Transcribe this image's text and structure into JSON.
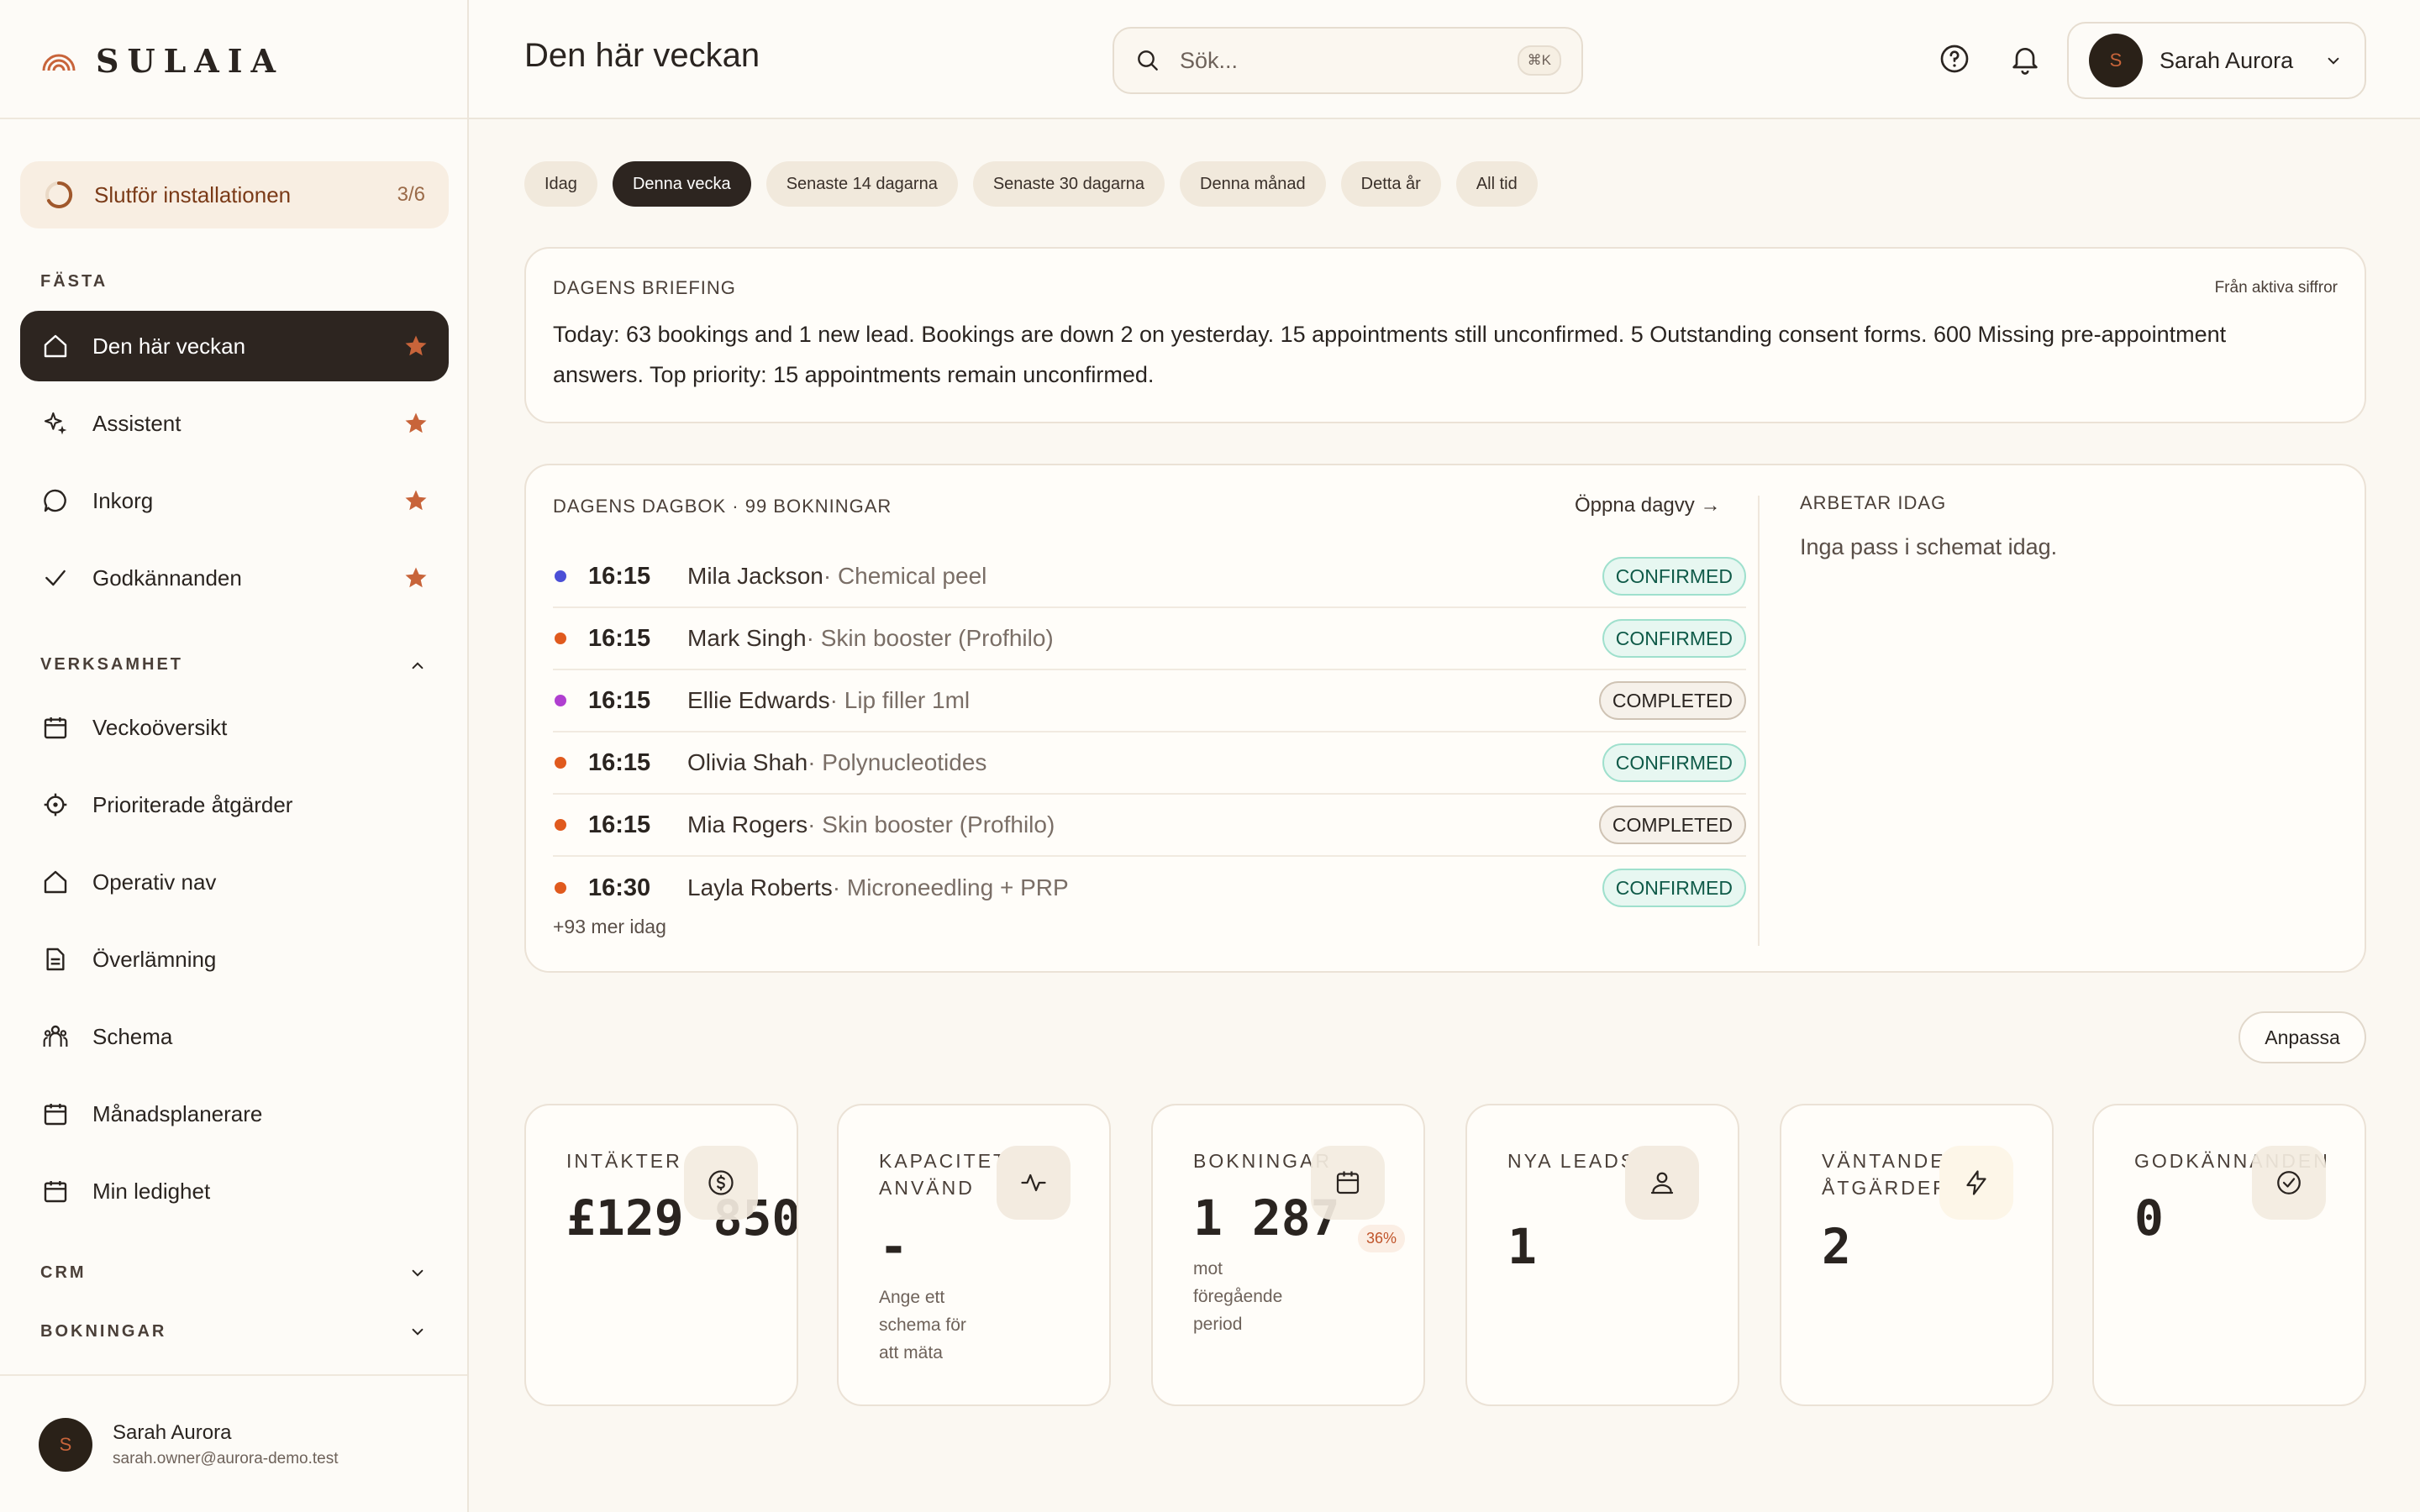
{
  "brand": {
    "name": "SULAIA"
  },
  "colors": {
    "accent": "#c8643a",
    "dark": "#2d2520",
    "confirmed": "#0f5a48"
  },
  "sidebar": {
    "setup": {
      "label": "Slutför installationen",
      "count": "3/6"
    },
    "pinned_label": "FÄSTA",
    "pinned": [
      {
        "label": "Den här veckan",
        "icon": "home-icon",
        "active": true
      },
      {
        "label": "Assistent",
        "icon": "sparkles-icon"
      },
      {
        "label": "Inkorg",
        "icon": "chat-bubble-icon"
      },
      {
        "label": "Godkännanden",
        "icon": "check-icon"
      }
    ],
    "business_label": "VERKSAMHET",
    "business": [
      {
        "label": "Veckoöversikt",
        "icon": "calendar-icon"
      },
      {
        "label": "Prioriterade åtgärder",
        "icon": "target-icon"
      },
      {
        "label": "Operativ nav",
        "icon": "home-icon"
      },
      {
        "label": "Överlämning",
        "icon": "document-icon"
      },
      {
        "label": "Schema",
        "icon": "people-icon"
      },
      {
        "label": "Månadsplanerare",
        "icon": "calendar-icon"
      },
      {
        "label": "Min ledighet",
        "icon": "calendar-icon"
      }
    ],
    "crm_label": "CRM",
    "bookings_label": "BOKNINGAR",
    "user": {
      "initial": "S",
      "name": "Sarah Aurora",
      "email": "sarah.owner@aurora-demo.test"
    }
  },
  "header": {
    "title": "Den här veckan",
    "search_placeholder": "Sök...",
    "search_shortcut": "⌘K",
    "user": {
      "initial": "S",
      "name": "Sarah Aurora"
    }
  },
  "filters": [
    "Idag",
    "Denna vecka",
    "Senaste 14 dagarna",
    "Senaste 30 dagarna",
    "Denna månad",
    "Detta år",
    "All tid"
  ],
  "active_filter": "Denna vecka",
  "briefing": {
    "heading": "DAGENS BRIEFING",
    "source": "Från aktiva siffror",
    "text": "Today: 63 bookings and 1 new lead. Bookings are down 2 on yesterday. 15 appointments still unconfirmed. 5 Outstanding consent forms. 600 Missing pre-appointment answers. Top priority: 15 appointments remain unconfirmed."
  },
  "diary": {
    "heading": "DAGENS DAGBOK · 99 BOKNINGAR",
    "open_link": "Öppna dagvy →",
    "rows": [
      {
        "color": "#4b4fd6",
        "time": "16:15",
        "client": "Mila Jackson",
        "service": " · Chemical peel",
        "status": "CONFIRMED"
      },
      {
        "color": "#e05a1e",
        "time": "16:15",
        "client": "Mark Singh",
        "service": " · Skin booster (Profhilo)",
        "status": "CONFIRMED"
      },
      {
        "color": "#b03fd0",
        "time": "16:15",
        "client": "Ellie Edwards",
        "service": " · Lip filler 1ml",
        "status": "COMPLETED"
      },
      {
        "color": "#e05a1e",
        "time": "16:15",
        "client": "Olivia Shah",
        "service": " · Polynucleotides",
        "status": "CONFIRMED"
      },
      {
        "color": "#e05a1e",
        "time": "16:15",
        "client": "Mia Rogers",
        "service": " · Skin booster (Profhilo)",
        "status": "COMPLETED"
      },
      {
        "color": "#e05a1e",
        "time": "16:30",
        "client": "Layla Roberts",
        "service": " · Microneedling + PRP",
        "status": "CONFIRMED"
      }
    ],
    "more": "+93 mer idag",
    "working_heading": "ARBETAR IDAG",
    "working_text": "Inga pass i schemat idag."
  },
  "customize_label": "Anpassa",
  "kpis": [
    {
      "label": "INTÄKTER",
      "icon": "dollar-icon",
      "value": "£129 850"
    },
    {
      "label": "KAPACITET ANVÄND",
      "icon": "activity-icon",
      "value": "-",
      "sub": "Ange ett schema för att mäta"
    },
    {
      "label": "BOKNINGAR",
      "icon": "calendar-icon",
      "value": "1 287",
      "badge": "36%",
      "sub": "mot föregående period"
    },
    {
      "label": "NYA LEADS",
      "icon": "user-icon",
      "value": "1"
    },
    {
      "label": "VÄNTANDE ÅTGÄRDER",
      "icon": "lightning-icon",
      "value": "2"
    },
    {
      "label": "GODKÄNNANDEN",
      "icon": "check-circle-icon",
      "value": "0"
    }
  ]
}
